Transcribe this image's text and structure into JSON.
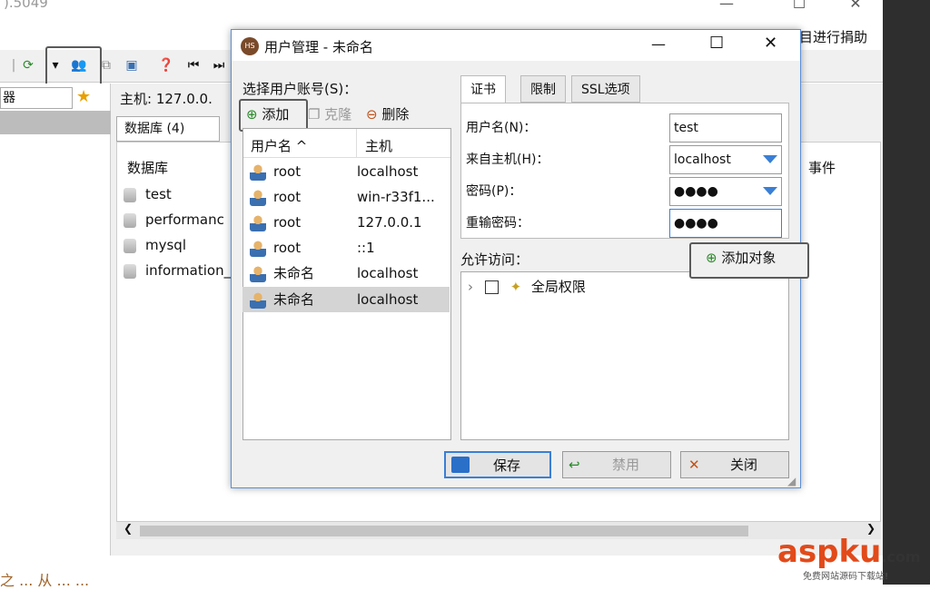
{
  "background_window": {
    "version_text": ").5049",
    "donate_text": "目进行捐助",
    "host_label": "主机: 127.0.0.",
    "nav_fragment": "器",
    "db_tab": "数据库 (4)",
    "db_column": "数据库",
    "events_column": "事件",
    "databases": [
      "test",
      "performanc",
      "mysql",
      "information_"
    ],
    "bottom_text": "之 ... 从 ...  ..."
  },
  "dialog": {
    "title": "用户管理 - 未命名",
    "select_user_label": "选择用户账号(S)：",
    "toolbar": {
      "add": "添加",
      "clone": "克隆",
      "delete": "删除"
    },
    "columns": {
      "username": "用户名",
      "host": "主机"
    },
    "users": [
      {
        "name": "root",
        "host": "localhost"
      },
      {
        "name": "root",
        "host": "win-r33f1..."
      },
      {
        "name": "root",
        "host": "127.0.0.1"
      },
      {
        "name": "root",
        "host": "::1"
      },
      {
        "name": "未命名",
        "host": "localhost"
      },
      {
        "name": "未命名",
        "host": "localhost"
      }
    ],
    "tabs": [
      "证书",
      "限制",
      "SSL选项"
    ],
    "form": {
      "username_label": "用户名(N)：",
      "username_value": "test",
      "host_label": "来自主机(H)：",
      "host_value": "localhost",
      "password_label": "密码(P)：",
      "password_value": "●●●●",
      "repeat_label": "重输密码：",
      "repeat_value": "●●●●"
    },
    "allow_access_label": "允许访问：",
    "add_object": "添加对象",
    "global_privileges": "全局权限",
    "buttons": {
      "save": "保存",
      "disable": "禁用",
      "close": "关闭"
    }
  },
  "watermark": {
    "brand": "aspku",
    "suffix": ".com",
    "subtitle": "免费网站源码下载站!"
  }
}
